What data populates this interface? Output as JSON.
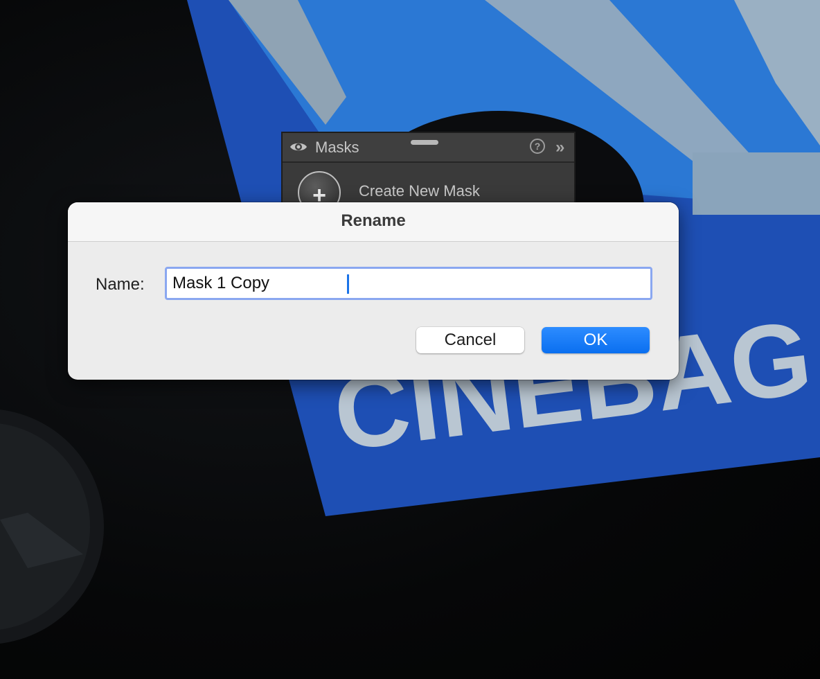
{
  "masks_panel": {
    "title": "Masks",
    "help_symbol": "?",
    "collapse_symbol": "»",
    "create_label": "Create New Mask",
    "add_symbol": "+",
    "icons": [
      "eye-icon",
      "help-icon",
      "collapse-icon",
      "plus-icon"
    ]
  },
  "dialog": {
    "title": "Rename",
    "name_label": "Name:",
    "name_value": "Mask 1 Copy",
    "cancel_label": "Cancel",
    "ok_label": "OK"
  },
  "colors": {
    "accent": "#0a6ff0",
    "focus_ring": "#8aa7f0"
  }
}
